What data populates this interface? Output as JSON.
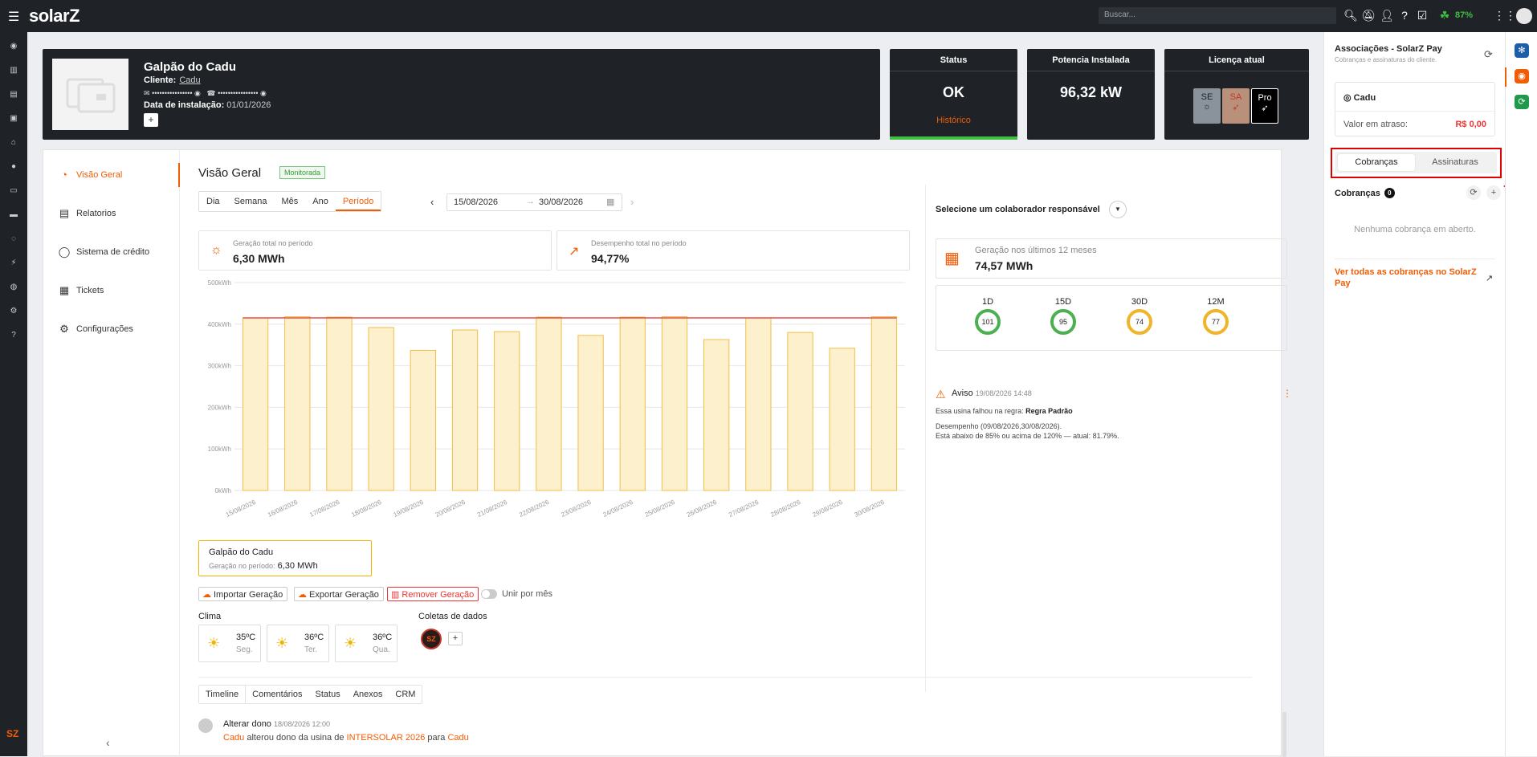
{
  "topbar": {
    "brand": "solarZ",
    "search_placeholder": "Buscar...",
    "battery": "87%"
  },
  "plant": {
    "name": "Galpão do Cadu",
    "client_label": "Cliente:",
    "client": "Cadu",
    "email_mask": "••••••••••••••••",
    "phone_mask": "••••••••••••••••",
    "install_label": "Data de instalação:",
    "install_date": "01/01/2026",
    "add": "+"
  },
  "status": {
    "label": "Status",
    "value": "OK",
    "link": "Histórico"
  },
  "power": {
    "label": "Potencia Instalada",
    "value": "96,32 kW"
  },
  "license": {
    "label": "Licença atual",
    "items": [
      "SE",
      "SA",
      "Pro"
    ]
  },
  "subnav": {
    "items": [
      "Visão Geral",
      "Relatorios",
      "Sistema de crédito",
      "Tickets",
      "Configurações"
    ]
  },
  "overview": {
    "title": "Visão Geral",
    "badge": "Monitorada",
    "periods": [
      "Dia",
      "Semana",
      "Mês",
      "Ano",
      "Período"
    ],
    "date_from": "15/08/2026",
    "date_to": "30/08/2026"
  },
  "summary": {
    "gen_caption": "Geração total no período",
    "gen_value": "6,30 MWh",
    "perf_caption": "Desempenho total no período",
    "perf_value": "94,77%"
  },
  "chart_data": {
    "type": "bar",
    "categories": [
      "15/08/2026",
      "16/08/2026",
      "17/08/2026",
      "18/08/2026",
      "19/08/2026",
      "20/08/2026",
      "21/08/2026",
      "22/08/2026",
      "23/08/2026",
      "24/08/2026",
      "25/08/2026",
      "26/08/2026",
      "27/08/2026",
      "28/08/2026",
      "29/08/2026",
      "30/08/2026"
    ],
    "values": [
      415,
      418,
      417,
      392,
      337,
      386,
      382,
      417,
      373,
      417,
      418,
      363,
      415,
      380,
      342,
      418
    ],
    "reference_line": 415,
    "yticks": [
      "0kWh",
      "100kWh",
      "200kWh",
      "300kWh",
      "400kWh",
      "500kWh"
    ],
    "ylim": [
      0,
      500
    ],
    "bar_color": "#fdf0cd",
    "bar_stroke": "#f3be45",
    "line_color": "#e94b4b",
    "grid": true
  },
  "plant_box": {
    "name": "Galpão do Cadu",
    "caption": "Geração no período:",
    "value": "6,30 MWh"
  },
  "actions": {
    "import": "Importar Geração",
    "export": "Exportar Geração",
    "remove": "Remover Geração",
    "merge": "Unir por mês"
  },
  "weather": {
    "label": "Clima",
    "days": [
      {
        "temp": "35ºC",
        "day": "Seg."
      },
      {
        "temp": "36ºC",
        "day": "Ter."
      },
      {
        "temp": "36ºC",
        "day": "Qua."
      }
    ]
  },
  "collect": {
    "label": "Coletas de dados",
    "sz": "SZ",
    "add": "+"
  },
  "bottom_tabs": [
    "Timeline",
    "Comentários",
    "Status",
    "Anexos",
    "CRM"
  ],
  "timeline": {
    "title": "Alterar dono",
    "time": "18/08/2026 12:00",
    "user": "Cadu",
    "t1": " alterou dono da usina de ",
    "plant": "INTERSOLAR 2026",
    "t2": " para ",
    "target": "Cadu"
  },
  "responsible": {
    "label": "Selecione um colaborador responsável"
  },
  "gen12": {
    "caption": "Geração nos últimos 12 meses",
    "value": "74,57 MWh"
  },
  "perf_rings": [
    {
      "label": "1D",
      "value": "101",
      "color": "#4caf50"
    },
    {
      "label": "15D",
      "value": "95",
      "color": "#4caf50"
    },
    {
      "label": "30D",
      "value": "74",
      "color": "#f0b429"
    },
    {
      "label": "12M",
      "value": "77",
      "color": "#f0b429"
    }
  ],
  "aviso": {
    "title": "Aviso",
    "time": "19/08/2026 14:48",
    "rule_text": "Essa usina falhou na regra: ",
    "rule": "Regra Padrão",
    "perf_line": "Desempenho (09/08/2026,30/08/2026).",
    "detail": "Está abaixo de 85% ou acima de 120% — atual: 81.79%."
  },
  "rpanel": {
    "title": "Associações - SolarZ Pay",
    "subtitle": "Cobranças e assinaturas do cliente.",
    "user": "Cadu",
    "late_label": "Valor em atraso:",
    "late_value": "R$ 0,00",
    "tabs": [
      "Cobranças",
      "Assinaturas"
    ],
    "section": "Cobranças",
    "count": "0",
    "empty": "Nenhuma cobrança em aberto.",
    "link": "Ver todas as cobranças no SolarZ Pay"
  }
}
